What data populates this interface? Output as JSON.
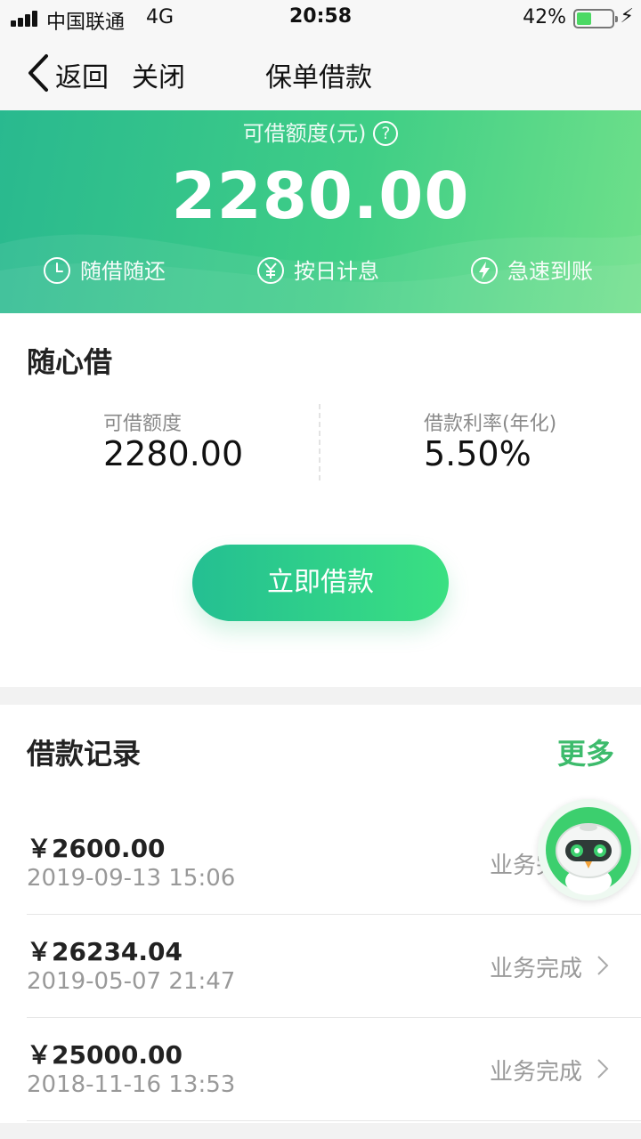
{
  "status_bar": {
    "carrier": "中国联通",
    "network": "4G",
    "time": "20:58",
    "battery_percent": "42%",
    "battery_level": 0.42
  },
  "nav": {
    "back_label": "返回",
    "close_label": "关闭",
    "title": "保单借款"
  },
  "hero": {
    "label": "可借额度(元)",
    "help_glyph": "?",
    "amount": "2280.00",
    "features": [
      {
        "icon": "clock-icon",
        "label": "随借随还"
      },
      {
        "icon": "yen-icon",
        "label": "按日计息"
      },
      {
        "icon": "lightning-icon",
        "label": "急速到账"
      }
    ],
    "colors": {
      "start": "#29b98f",
      "end": "#6fe08a"
    }
  },
  "borrow": {
    "title": "随心借",
    "limit_label": "可借额度",
    "limit_value": "2280.00",
    "rate_label": "借款利率(年化)",
    "rate_value": "5.50%",
    "button_label": "立即借款"
  },
  "records": {
    "title": "借款记录",
    "more_label": "更多",
    "items": [
      {
        "amount": "￥2600.00",
        "date": "2019-09-13 15:06",
        "status": "业务完成"
      },
      {
        "amount": "￥26234.04",
        "date": "2019-05-07 21:47",
        "status": "业务完成"
      },
      {
        "amount": "￥25000.00",
        "date": "2018-11-16 13:53",
        "status": "业务完成"
      }
    ]
  },
  "colors": {
    "accent_green": "#3dbb6c",
    "button_start": "#24bf92",
    "button_end": "#3ae082"
  }
}
